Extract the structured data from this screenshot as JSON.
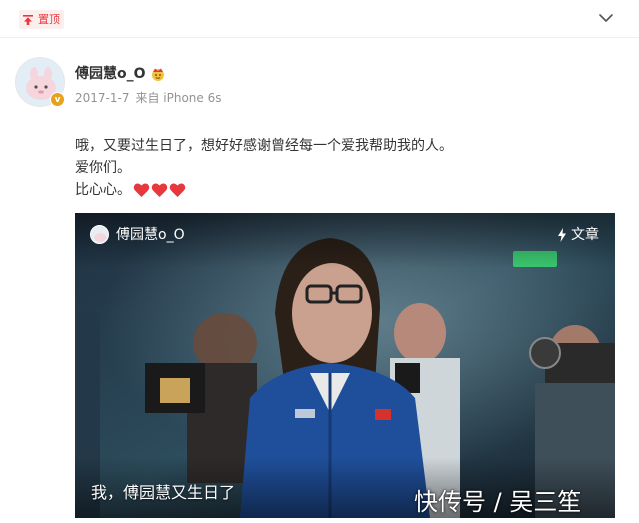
{
  "pin_bar": {
    "pin_label": "置顶",
    "icons": {
      "pin": "pin-icon",
      "fold": "chevron-down-icon"
    }
  },
  "post": {
    "author": {
      "name": "傅园慧o_O",
      "badge": "vip-badge",
      "badge_text": "v"
    },
    "meta": {
      "date": "2017-1-7",
      "source": "来自 iPhone 6s"
    },
    "lines": [
      "哦，又要过生日了，想好好感谢曾经每一个爱我帮助我的人。",
      "爱你们。",
      "比心心。"
    ],
    "hearts_count": 3,
    "heart_color": "#e8383d"
  },
  "video_card": {
    "user": "傅园慧o_O",
    "article_label": "文章",
    "caption": "我，傅园慧又生日了"
  },
  "watermark": "快传号 / 吴三笙",
  "colors": {
    "accent_red": "#e8383d",
    "meta_gray": "#939393",
    "text": "#333333",
    "vip_gold": "#e6a21d"
  }
}
